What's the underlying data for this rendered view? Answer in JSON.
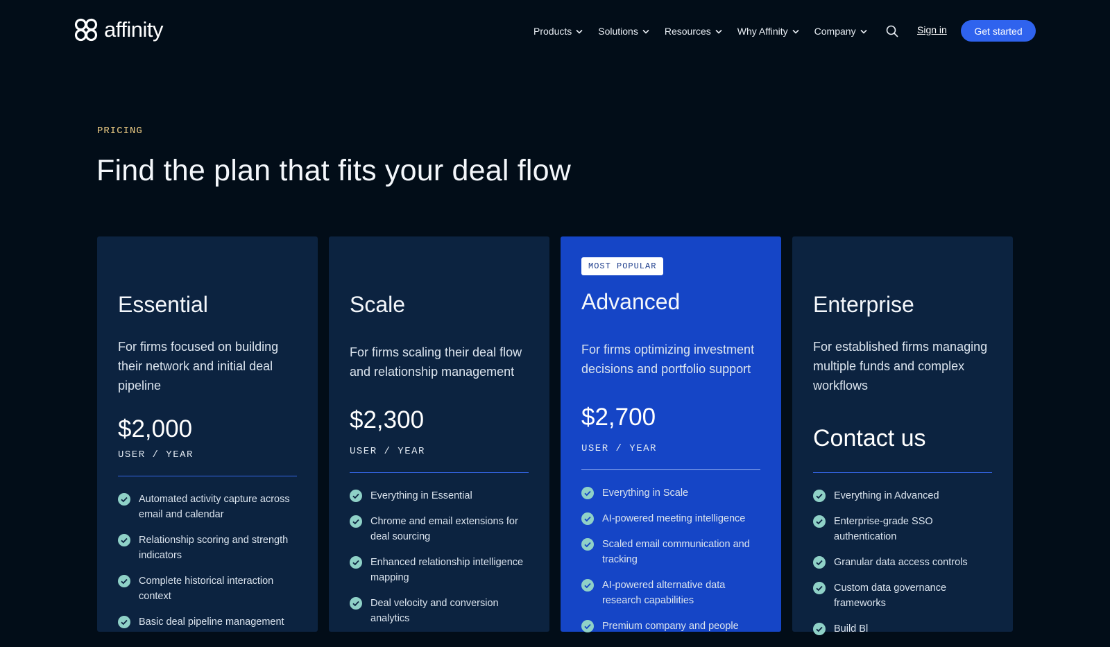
{
  "nav": {
    "logo_text": "affinity",
    "menu": [
      {
        "label": "Products"
      },
      {
        "label": "Solutions"
      },
      {
        "label": "Resources"
      },
      {
        "label": "Why Affinity"
      },
      {
        "label": "Company"
      }
    ],
    "search_icon": "search-icon",
    "sign_in": "Sign in",
    "get_started": "Get started"
  },
  "hero": {
    "eyebrow": "PRICING",
    "title": "Find the plan that fits your deal flow"
  },
  "colors": {
    "background": "#020d18",
    "card": "#0c2340",
    "featured_card": "#1545c6",
    "accent": "#2f63ee",
    "eyebrow": "#f1cf86",
    "check": "#8fd1c7"
  },
  "plans": [
    {
      "name": "Essential",
      "description": "For firms focused on building their network and initial deal pipeline",
      "price": "$2,000",
      "unit": "USER / YEAR",
      "features": [
        "Automated activity capture across email and calendar",
        "Relationship scoring and strength indicators",
        "Complete historical interaction context",
        "Basic deal pipeline management"
      ]
    },
    {
      "name": "Scale",
      "description": "For firms scaling their deal flow and relationship management",
      "price": "$2,300",
      "unit": "USER / YEAR",
      "features": [
        "Everything in Essential",
        "Chrome and email extensions for deal sourcing",
        "Enhanced relationship intelligence mapping",
        "Deal velocity and conversion analytics"
      ]
    },
    {
      "badge": "MOST POPULAR",
      "name": "Advanced",
      "description": "For firms optimizing investment decisions and portfolio support",
      "price": "$2,700",
      "unit": "USER / YEAR",
      "features": [
        "Everything in Scale",
        "AI-powered meeting intelligence",
        "Scaled email communication and tracking",
        "AI-powered alternative data research capabilities",
        "Premium company and people"
      ]
    },
    {
      "name": "Enterprise",
      "description": "For established firms managing multiple funds and complex workflows",
      "cta": "Contact us",
      "features": [
        "Everything in Advanced",
        "Enterprise-grade SSO authentication",
        "Granular data access controls",
        "Custom data governance frameworks",
        "Build Bl"
      ]
    }
  ]
}
